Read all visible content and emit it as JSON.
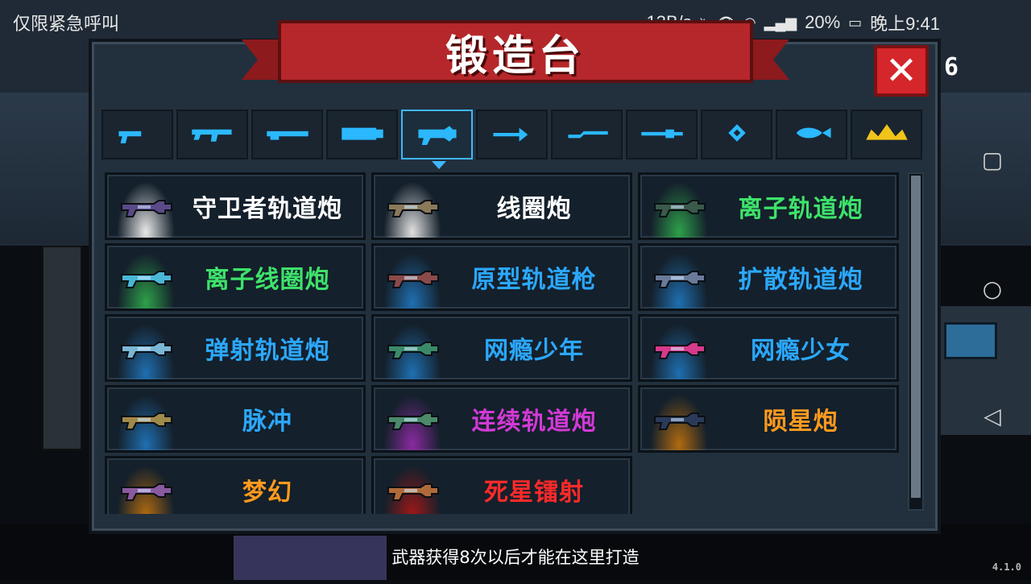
{
  "status_bar": {
    "left_text": "仅限紧急呼叫",
    "speed": "13B/s",
    "battery": "20%",
    "time": "晚上9:41"
  },
  "title": "锻造台",
  "close_label": "✕",
  "gem_count": "6",
  "tabs": [
    {
      "icon": "pistol-icon"
    },
    {
      "icon": "assault-rifle-icon"
    },
    {
      "icon": "shotgun-icon"
    },
    {
      "icon": "heavy-gun-icon"
    },
    {
      "icon": "rail-gun-icon",
      "active": true
    },
    {
      "icon": "crossbow-icon"
    },
    {
      "icon": "melee-icon"
    },
    {
      "icon": "sniper-icon"
    },
    {
      "icon": "throwable-icon"
    },
    {
      "icon": "fish-icon"
    },
    {
      "icon": "special-crown-icon"
    }
  ],
  "weapons": [
    {
      "name": "守卫者轨道炮",
      "color": "#ffffff",
      "glow": "#e8e8e8",
      "weapon_color": "#5a4a8a"
    },
    {
      "name": "线圈炮",
      "color": "#ffffff",
      "glow": "#e0e0e0",
      "weapon_color": "#8a7a5a"
    },
    {
      "name": "离子轨道炮",
      "color": "#3ee26a",
      "glow": "#2ea04a",
      "weapon_color": "#3a5a4a"
    },
    {
      "name": "离子线圈炮",
      "color": "#3ee26a",
      "glow": "#2ea04a",
      "weapon_color": "#4ab6d6"
    },
    {
      "name": "原型轨道枪",
      "color": "#2ba8ff",
      "glow": "#1f6fb0",
      "weapon_color": "#8a4a4a"
    },
    {
      "name": "扩散轨道炮",
      "color": "#2ba8ff",
      "glow": "#1f6fb0",
      "weapon_color": "#6a7a9a"
    },
    {
      "name": "弹射轨道炮",
      "color": "#2ba8ff",
      "glow": "#1f6fb0",
      "weapon_color": "#7ab6d6"
    },
    {
      "name": "网瘾少年",
      "color": "#2ba8ff",
      "glow": "#1f6fb0",
      "weapon_color": "#3a8a6a"
    },
    {
      "name": "网瘾少女",
      "color": "#2ba8ff",
      "glow": "#1f6fb0",
      "weapon_color": "#d63a8a"
    },
    {
      "name": "脉冲",
      "color": "#2ba8ff",
      "glow": "#1f6fb0",
      "weapon_color": "#a08a4a"
    },
    {
      "name": "连续轨道炮",
      "color": "#d23ad6",
      "glow": "#8a2aa0",
      "weapon_color": "#4a8a6a"
    },
    {
      "name": "陨星炮",
      "color": "#ff9a1e",
      "glow": "#b06a10",
      "weapon_color": "#2a3a5a"
    },
    {
      "name": "梦幻",
      "color": "#ff9a1e",
      "glow": "#b06a10",
      "weapon_color": "#8a5aa0"
    },
    {
      "name": "死星镭射",
      "color": "#ff2a2a",
      "glow": "#a01818",
      "weapon_color": "#b06a3a"
    }
  ],
  "scroll_fraction": 0.97,
  "hint": "武器获得8次以后才能在这里打造",
  "version": "4.1.0"
}
